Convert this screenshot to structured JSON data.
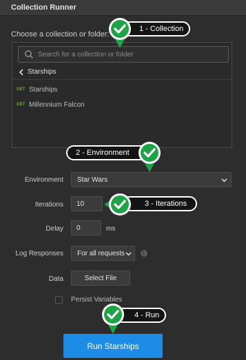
{
  "window": {
    "title": "Collection Runner"
  },
  "collection_picker": {
    "label": "Choose a collection or folder:",
    "search_placeholder": "Search for a collection or folder",
    "breadcrumb": "Starships",
    "requests": [
      {
        "method": "GET",
        "name": "Starships"
      },
      {
        "method": "GET",
        "name": "Millennium Falcon"
      }
    ]
  },
  "form": {
    "environment": {
      "label": "Environment",
      "value": "Star Wars"
    },
    "iterations": {
      "label": "Iterations",
      "value": "10"
    },
    "delay": {
      "label": "Delay",
      "value": "0",
      "unit": "ms"
    },
    "log_responses": {
      "label": "Log Responses",
      "value": "For all requests",
      "info_icon": "i"
    },
    "data": {
      "label": "Data",
      "button": "Select File"
    },
    "persist": {
      "label": "Persist Variables"
    }
  },
  "run_button": {
    "label": "Run Starships"
  },
  "callouts": [
    {
      "text": "1 - Collection"
    },
    {
      "text": "2 - Environment"
    },
    {
      "text": "3 - Iterations"
    },
    {
      "text": "4 - Run"
    }
  ],
  "colors": {
    "accent_blue": "#1d8ce6",
    "marker_green": "#1ea446",
    "get_method": "#7aa33d"
  }
}
